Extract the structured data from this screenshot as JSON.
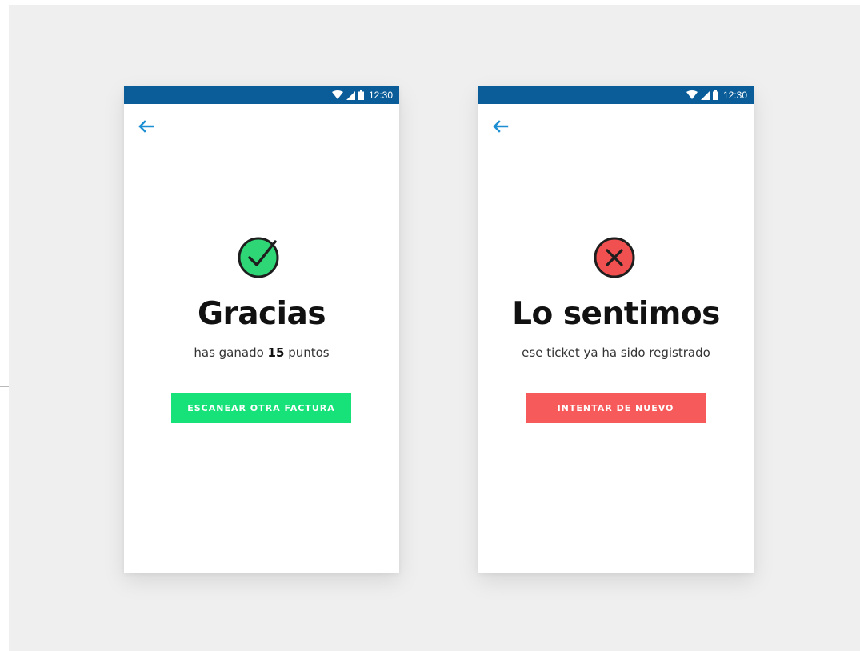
{
  "status_bar": {
    "time": "12:30",
    "background": "#0a5d98",
    "icons": [
      "wifi-icon",
      "signal-icon",
      "battery-icon"
    ]
  },
  "screens": {
    "success": {
      "back_icon": "arrow-left-icon",
      "result_icon": "check-circle-icon",
      "icon_color": "#2fd676",
      "title": "Gracias",
      "subtitle_prefix": "has ganado ",
      "points": "15",
      "subtitle_suffix": " puntos",
      "button_label": "ESCANEAR OTRA FACTURA",
      "button_color": "#17e27a"
    },
    "error": {
      "back_icon": "arrow-left-icon",
      "result_icon": "x-circle-icon",
      "icon_color": "#f0504f",
      "title": "Lo sentimos",
      "subtitle": "ese ticket ya ha sido registrado",
      "button_label": "INTENTAR DE NUEVO",
      "button_color": "#f65a5a"
    }
  },
  "accent_color": "#1c8ed2"
}
